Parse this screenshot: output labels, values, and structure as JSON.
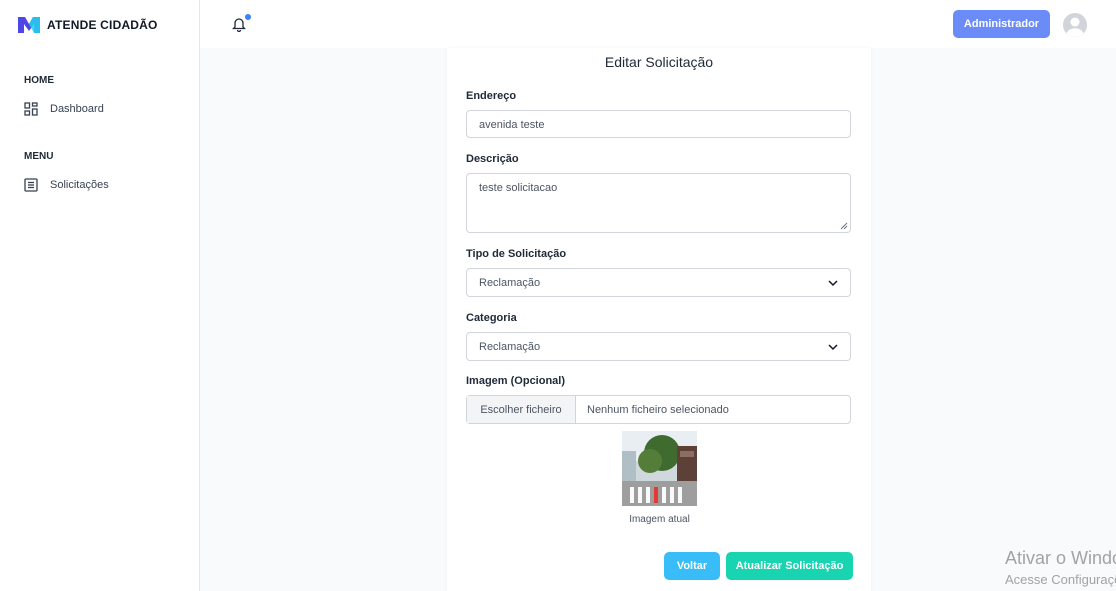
{
  "brand": {
    "name": "ATENDE CIDADÃO"
  },
  "sidebar": {
    "sections": [
      {
        "title": "HOME",
        "items": [
          {
            "label": "Dashboard",
            "icon": "dashboard-icon"
          }
        ]
      },
      {
        "title": "MENU",
        "items": [
          {
            "label": "Solicitações",
            "icon": "list-icon"
          }
        ]
      }
    ]
  },
  "topbar": {
    "admin_label": "Administrador",
    "notification": "bell-icon"
  },
  "form": {
    "title": "Editar Solicitação",
    "endereco": {
      "label": "Endereço",
      "value": "avenida teste"
    },
    "descricao": {
      "label": "Descrição",
      "value": "teste solicitacao"
    },
    "tipo": {
      "label": "Tipo de Solicitação",
      "value": "Reclamação"
    },
    "categoria": {
      "label": "Categoria",
      "value": "Reclamação"
    },
    "imagem": {
      "label": "Imagem (Opcional)",
      "button": "Escolher ficheiro",
      "status": "Nenhum ficheiro selecionado",
      "caption": "Imagem atual"
    },
    "actions": {
      "back": "Voltar",
      "update": "Atualizar Solicitação"
    }
  },
  "watermark": {
    "line1": "Ativar o Windows",
    "line2": "Acesse Configurações"
  },
  "colors": {
    "accent": "#6b8cf7",
    "back": "#38bdf8",
    "update": "#19d4b0"
  }
}
